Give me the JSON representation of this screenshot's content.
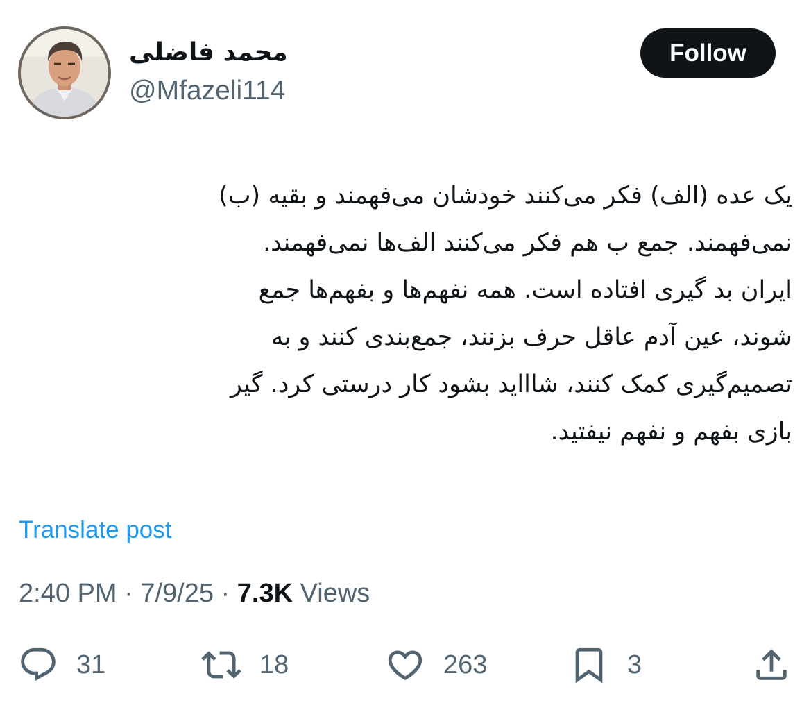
{
  "author": {
    "display_name": "محمد فاضلی",
    "handle": "@Mfazeli114"
  },
  "follow_label": "Follow",
  "tweet": {
    "lines": [
      "یک عده (الف) فکر می‌کنند خودشان می‌فهمند و بقیه (ب)",
      "نمی‌فهمند. جمع ب هم فکر می‌کنند الف‌ها نمی‌فهمند.",
      "ایران بد گیری افتاده است. همه نفهم‌ها و بفهم‌ها جمع",
      "شوند، عین آدم عاقل حرف بزنند، جمع‌بندی کنند و به",
      "تصمیم‌گیری کمک کنند، شاااید بشود کار درستی کرد. گیر",
      "بازی بفهم و نفهم نیفتید."
    ]
  },
  "translate_label": "Translate post",
  "meta": {
    "time": "2:40 PM",
    "date": "7/9/25",
    "separator": " · ",
    "views_count": "7.3K",
    "views_label": " Views"
  },
  "actions": {
    "replies": "31",
    "reposts": "18",
    "likes": "263",
    "bookmarks": "3"
  },
  "icons": {
    "reply": "reply-icon",
    "repost": "repost-icon",
    "like": "heart-icon",
    "bookmark": "bookmark-icon",
    "share": "share-icon"
  },
  "colors": {
    "text": "#0f1419",
    "secondary": "#536471",
    "link": "#1d9bf0",
    "button_bg": "#0f1419"
  }
}
